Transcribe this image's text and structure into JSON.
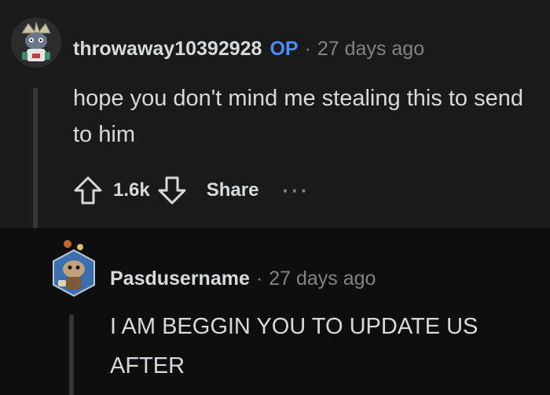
{
  "comments": [
    {
      "author": "throwaway10392928",
      "badge": "OP",
      "separator": "·",
      "time": "27 days ago",
      "body": "hope you don't mind me stealing this to send to him",
      "score": "1.6k",
      "share_label": "Share",
      "more_label": "···",
      "avatar_icon": "snoo-avatar-icon"
    },
    {
      "author": "Pasdusername",
      "separator": "·",
      "time": "27 days ago",
      "body": "I AM BEGGIN YOU TO UPDATE US AFTER",
      "avatar_icon": "snoo-avatar-icon"
    }
  ],
  "colors": {
    "op_badge": "#4c8ef7",
    "background": "#1a1a1b",
    "reply_background": "#0e0e0f",
    "muted_text": "#818384"
  }
}
